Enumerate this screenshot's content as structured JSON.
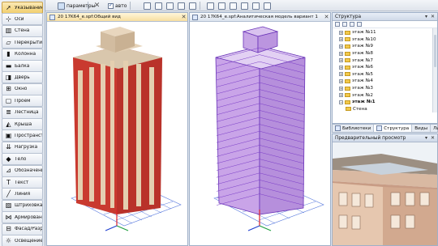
{
  "toolbar": {
    "params_label": "параметры",
    "auto_label": "авто",
    "auto_checked": true
  },
  "tools": [
    {
      "label": "Указывание",
      "icon": "pointer-icon",
      "glyph": "➚"
    },
    {
      "label": "Оси",
      "icon": "axes-icon",
      "glyph": "⊹"
    },
    {
      "label": "Стена",
      "icon": "wall-icon",
      "glyph": "▥"
    },
    {
      "label": "Перекрытие",
      "icon": "slab-icon",
      "glyph": "▱"
    },
    {
      "label": "Колонна",
      "icon": "column-icon",
      "glyph": "▮"
    },
    {
      "label": "Балка",
      "icon": "beam-icon",
      "glyph": "▬"
    },
    {
      "label": "Дверь",
      "icon": "door-icon",
      "glyph": "◨"
    },
    {
      "label": "Окно",
      "icon": "window-icon",
      "glyph": "⊞"
    },
    {
      "label": "Проём",
      "icon": "opening-icon",
      "glyph": "▢"
    },
    {
      "label": "Лестница",
      "icon": "stair-icon",
      "glyph": "≣"
    },
    {
      "label": "Крыша",
      "icon": "roof-icon",
      "glyph": "◭"
    },
    {
      "label": "Пространство",
      "icon": "space-icon",
      "glyph": "▣"
    },
    {
      "label": "Нагрузка",
      "icon": "load-icon",
      "glyph": "⇊"
    },
    {
      "label": "Тело",
      "icon": "body-icon",
      "glyph": "◆"
    },
    {
      "label": "Обозначение",
      "icon": "annotation-icon",
      "glyph": "⊿"
    },
    {
      "label": "Текст",
      "icon": "text-icon",
      "glyph": "T"
    },
    {
      "label": "Линия",
      "icon": "line-icon",
      "glyph": "╱"
    },
    {
      "label": "Штриховка",
      "icon": "hatch-icon",
      "glyph": "▨"
    },
    {
      "label": "Армирование",
      "icon": "rebar-icon",
      "glyph": "⋈"
    },
    {
      "label": "Фасад/Разрез",
      "icon": "section-icon",
      "glyph": "⊟"
    },
    {
      "label": "Освещение",
      "icon": "lighting-icon",
      "glyph": "☼"
    }
  ],
  "docs": {
    "left_title": "20 17K64_e.spf:Общий вид",
    "right_title": "20 17K64_e.spf:Аналитическая модель вариант 1"
  },
  "structure_panel": {
    "title": "Структура",
    "items": [
      {
        "label": "этаж №11",
        "expanded": false,
        "bold": false
      },
      {
        "label": "этаж №10",
        "expanded": false,
        "bold": false
      },
      {
        "label": "этаж №9",
        "expanded": false,
        "bold": false
      },
      {
        "label": "этаж №8",
        "expanded": false,
        "bold": false
      },
      {
        "label": "этаж №7",
        "expanded": false,
        "bold": false
      },
      {
        "label": "этаж №6",
        "expanded": false,
        "bold": false
      },
      {
        "label": "этаж №5",
        "expanded": false,
        "bold": false
      },
      {
        "label": "этаж №4",
        "expanded": false,
        "bold": false
      },
      {
        "label": "этаж №3",
        "expanded": false,
        "bold": false
      },
      {
        "label": "этаж №2",
        "expanded": false,
        "bold": false
      },
      {
        "label": "этаж №1",
        "expanded": true,
        "bold": true
      },
      {
        "label": "Стена",
        "expanded": false,
        "bold": false
      },
      {
        "label": "Перекрытие",
        "expanded": false,
        "bold": false
      }
    ]
  },
  "panel_tabs": [
    {
      "label": "Библиотеки",
      "active": false
    },
    {
      "label": "Структура",
      "active": true
    },
    {
      "label": "Виды",
      "active": false
    },
    {
      "label": "Листы",
      "active": false
    }
  ],
  "preview_panel": {
    "title": "Предварительный просмотр"
  },
  "colors": {
    "facade_red": "#c93a2f",
    "facade_light": "#e8c9a8",
    "analytic_purple": "#7a3cc8",
    "grid_blue": "#3b5bd6"
  }
}
